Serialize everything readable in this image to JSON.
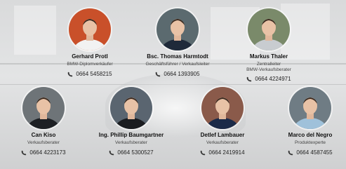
{
  "people": [
    {
      "name": "Gerhard Protl",
      "role_lines": [
        "BMW-Diplomverkäufer"
      ],
      "phone": "0664 5458215",
      "avatar_bg": "#c9502a",
      "shirt": "#f2f2f2",
      "avatar_icon": "person-portrait-icon"
    },
    {
      "name": "Bsc. Thomas Harmtodt",
      "role_lines": [
        "Geschäftsführer / Verkaufsleiter"
      ],
      "phone": "0664 1393905",
      "avatar_bg": "#5b6a6f",
      "shirt": "#1f2a3a",
      "avatar_icon": "person-portrait-icon"
    },
    {
      "name": "Markus Thaler",
      "role_lines": [
        "Zentralleiter",
        "BMW-Verkaufsberater"
      ],
      "phone": "0664 4224971",
      "avatar_bg": "#7a8a6a",
      "shirt": "#c8ccd0",
      "avatar_icon": "person-portrait-icon"
    },
    {
      "name": "Can Kiso",
      "role_lines": [
        "Verkaufsberater"
      ],
      "phone": "0664 4223173",
      "avatar_bg": "#6e7478",
      "shirt": "#1d2024",
      "avatar_icon": "person-portrait-icon"
    },
    {
      "name": "Ing. Phillip Baumgartner",
      "role_lines": [
        "Verkaufsberater"
      ],
      "phone": "0664 5300527",
      "avatar_bg": "#5a6570",
      "shirt": "#1a1c20",
      "avatar_icon": "person-portrait-icon"
    },
    {
      "name": "Detlef Lambauer",
      "role_lines": [
        "Verkaufsberater"
      ],
      "phone": "0664 2419914",
      "avatar_bg": "#8a5a4a",
      "shirt": "#1b2a48",
      "avatar_icon": "person-portrait-icon"
    },
    {
      "name": "Marco del Negro",
      "role_lines": [
        "Produktexperte"
      ],
      "phone": "0664 4587455",
      "avatar_bg": "#6f7c84",
      "shirt": "#9fc1da",
      "avatar_icon": "person-portrait-icon"
    }
  ]
}
